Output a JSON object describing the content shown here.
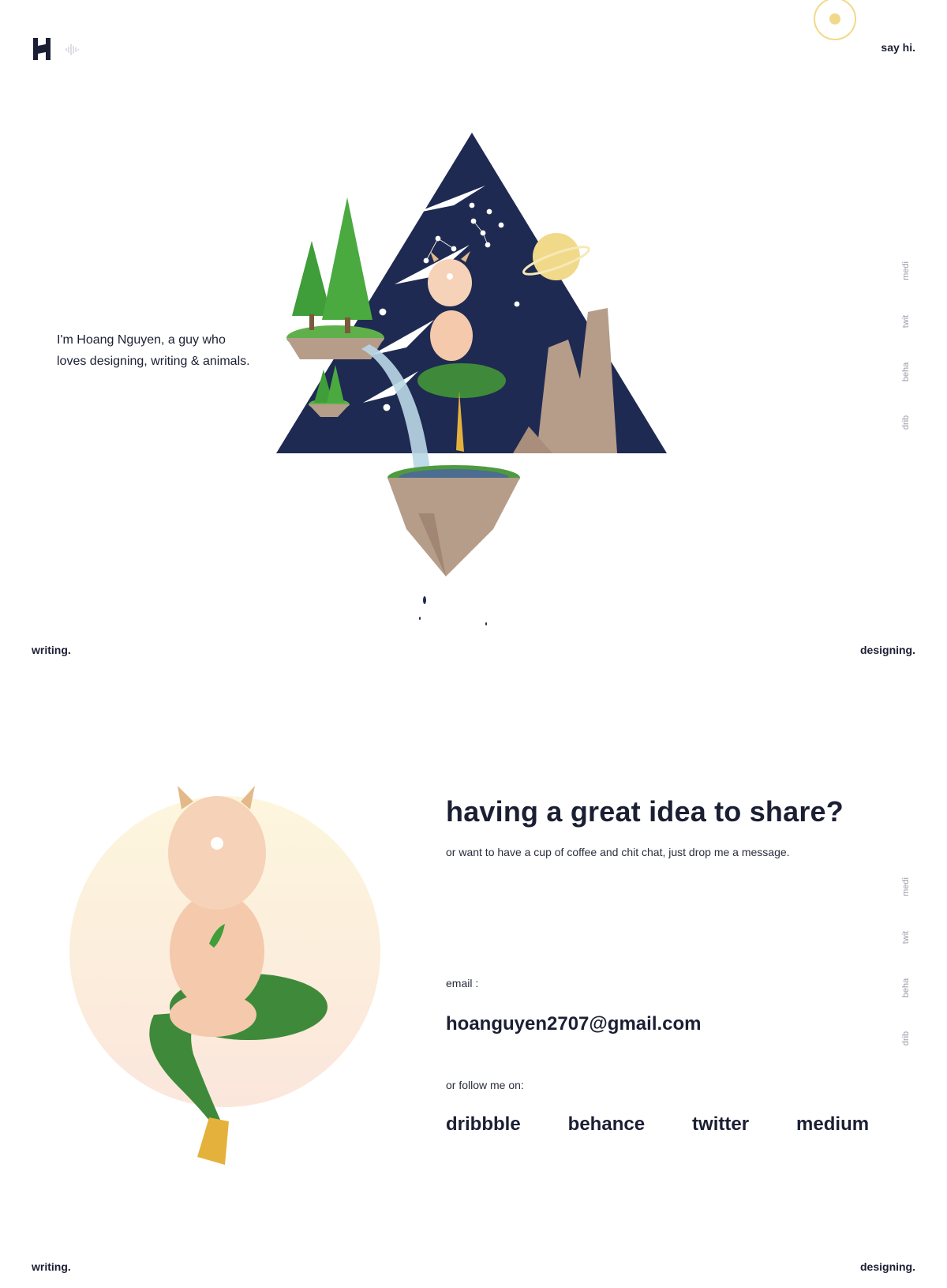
{
  "header": {
    "say_hi": "say hi."
  },
  "intro": {
    "line1": "I'm Hoang Nguyen, a guy who",
    "line2": "loves designing, writing & animals."
  },
  "nav": {
    "writing": "writing.",
    "designing": "designing."
  },
  "social_rail": [
    "medi",
    "twit",
    "beha",
    "drib"
  ],
  "contact": {
    "headline": "having a great idea to share?",
    "subline": "or want to have a cup of coffee and chit chat, just drop me a message.",
    "email_label": "email :",
    "email": "hoanguyen2707@gmail.com",
    "follow_label": "or follow me on:",
    "links": [
      "dribbble",
      "behance",
      "twitter",
      "medium"
    ]
  },
  "colors": {
    "ink": "#1b1f33",
    "accent_yellow": "#f1d98a",
    "triangle_navy": "#1f2a52",
    "tree_green": "#3f9d3a",
    "rock": "#b69d8a"
  }
}
